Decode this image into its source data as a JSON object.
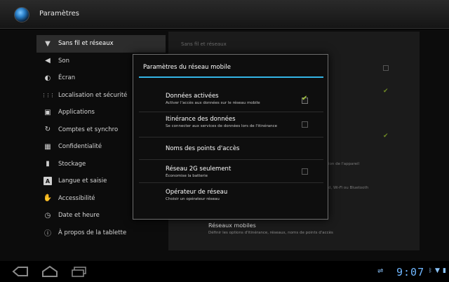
{
  "app": {
    "title": "Paramètres",
    "icon": "settings-app-icon"
  },
  "sidebar": {
    "items": [
      {
        "label": "Sans fil et réseaux",
        "icon": "wifi-icon",
        "glyph": "▼",
        "active": true
      },
      {
        "label": "Son",
        "icon": "speaker-icon",
        "glyph": "◀",
        "active": false
      },
      {
        "label": "Écran",
        "icon": "brightness-icon",
        "glyph": "◐",
        "active": false
      },
      {
        "label": "Localisation et sécurité",
        "icon": "grid-lock-icon",
        "glyph": "⋮⋮⋮",
        "active": false
      },
      {
        "label": "Applications",
        "icon": "applications-icon",
        "glyph": "▣",
        "active": false
      },
      {
        "label": "Comptes et synchro",
        "icon": "sync-icon",
        "glyph": "↻",
        "active": false
      },
      {
        "label": "Confidentialité",
        "icon": "privacy-icon",
        "glyph": "▦",
        "active": false
      },
      {
        "label": "Stockage",
        "icon": "storage-icon",
        "glyph": "▮",
        "active": false
      },
      {
        "label": "Langue et saisie",
        "icon": "keyboard-letter-icon",
        "glyph": "A",
        "active": false
      },
      {
        "label": "Accessibilité",
        "icon": "hand-icon",
        "glyph": "✋",
        "active": false
      },
      {
        "label": "Date et heure",
        "icon": "clock-icon",
        "glyph": "◷",
        "active": false
      },
      {
        "label": "À propos de la tablette",
        "icon": "info-icon",
        "glyph": "ⓘ",
        "active": false
      }
    ]
  },
  "detail": {
    "header": "Sans fil et réseaux",
    "side_texts": [
      "ion de l'appareil",
      "d, Wi-Fi ou Bluetooth"
    ],
    "mobile_networks": {
      "title": "Réseaux mobiles",
      "subtitle": "Définir les options d'itinérance, réseaux, noms de points d'accès"
    }
  },
  "dialog": {
    "title": "Paramètres du réseau mobile",
    "accent_color": "#33b5e5",
    "rows": [
      {
        "title": "Données activées",
        "subtitle": "Activer l'accès aux données sur le réseau mobile",
        "checkbox": true,
        "checked": true
      },
      {
        "title": "Itinérance des données",
        "subtitle": "Se connecter aux services de données lors de l'itinérance",
        "checkbox": true,
        "checked": false
      },
      {
        "title": "Noms des points d'accès",
        "subtitle": "",
        "checkbox": false,
        "checked": false
      },
      {
        "title": "Réseau 2G seulement",
        "subtitle": "Économise la batterie",
        "checkbox": true,
        "checked": false
      },
      {
        "title": "Opérateur de réseau",
        "subtitle": "Choisir un opérateur réseau",
        "checkbox": false,
        "checked": false
      }
    ]
  },
  "system_bar": {
    "time": "9:07",
    "buttons": [
      "back-icon",
      "home-icon",
      "recent-apps-icon"
    ],
    "status_icons": [
      "usb-icon",
      "bluetooth-icon",
      "wifi-signal-icon",
      "battery-icon"
    ]
  }
}
